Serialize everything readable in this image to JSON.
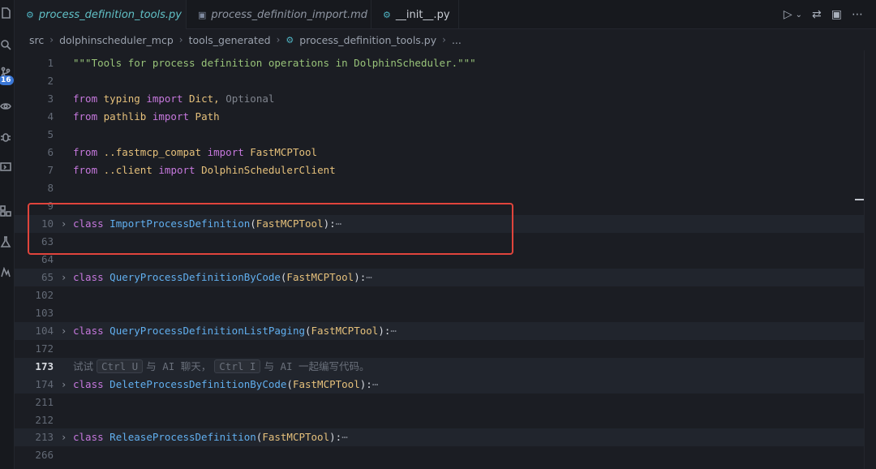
{
  "tabs": [
    {
      "label": "process_definition_tools.py",
      "icon": "python-icon",
      "active": true
    },
    {
      "label": "process_definition_import.md",
      "icon": "markdown-icon",
      "active": false
    },
    {
      "label": "__init__.py",
      "icon": "python-icon",
      "active": false
    }
  ],
  "activity": {
    "badge_count": "16"
  },
  "breadcrumb": {
    "items": [
      "src",
      "dolphinscheduler_mcp",
      "tools_generated",
      "process_definition_tools.py",
      "..."
    ]
  },
  "code": {
    "l1": {
      "num": "1",
      "text": "\"\"\"Tools for process definition operations in DolphinScheduler.\"\"\""
    },
    "l2": {
      "num": "2"
    },
    "l3": {
      "num": "3",
      "kw1": "from",
      "mod": "typing",
      "kw2": "import",
      "name": "Dict,",
      "extra": "Optional"
    },
    "l4": {
      "num": "4",
      "kw1": "from",
      "mod": "pathlib",
      "kw2": "import",
      "name": "Path"
    },
    "l5": {
      "num": "5"
    },
    "l6": {
      "num": "6",
      "kw1": "from",
      "mod": "..fastmcp_compat",
      "kw2": "import",
      "name": "FastMCPTool"
    },
    "l7": {
      "num": "7",
      "kw1": "from",
      "mod": "..client",
      "kw2": "import",
      "name": "DolphinSchedulerClient"
    },
    "l8": {
      "num": "8"
    },
    "l9": {
      "num": "9"
    },
    "l10": {
      "num": "10",
      "kw": "class",
      "cls": "ImportProcessDefinition",
      "base": "FastMCPTool",
      "ell": "⋯"
    },
    "l63": {
      "num": "63"
    },
    "l64": {
      "num": "64"
    },
    "l65": {
      "num": "65",
      "kw": "class",
      "cls": "QueryProcessDefinitionByCode",
      "base": "FastMCPTool",
      "ell": "⋯"
    },
    "l102": {
      "num": "102"
    },
    "l103": {
      "num": "103"
    },
    "l104": {
      "num": "104",
      "kw": "class",
      "cls": "QueryProcessDefinitionListPaging",
      "base": "FastMCPTool",
      "ell": "⋯"
    },
    "l172": {
      "num": "172"
    },
    "l173": {
      "num": "173",
      "hint_a": "试试",
      "key1": "Ctrl U",
      "hint_b": "与 AI 聊天，",
      "key2": "Ctrl I",
      "hint_c": "与 AI 一起编写代码。"
    },
    "l174": {
      "num": "174",
      "kw": "class",
      "cls": "DeleteProcessDefinitionByCode",
      "base": "FastMCPTool",
      "ell": "⋯"
    },
    "l211": {
      "num": "211"
    },
    "l212": {
      "num": "212"
    },
    "l213": {
      "num": "213",
      "kw": "class",
      "cls": "ReleaseProcessDefinition",
      "base": "FastMCPTool",
      "ell": "⋯"
    },
    "l266": {
      "num": "266"
    }
  },
  "colors": {
    "highlight_box": "#e0443c",
    "keyword": "#c678dd",
    "string": "#98c379"
  }
}
